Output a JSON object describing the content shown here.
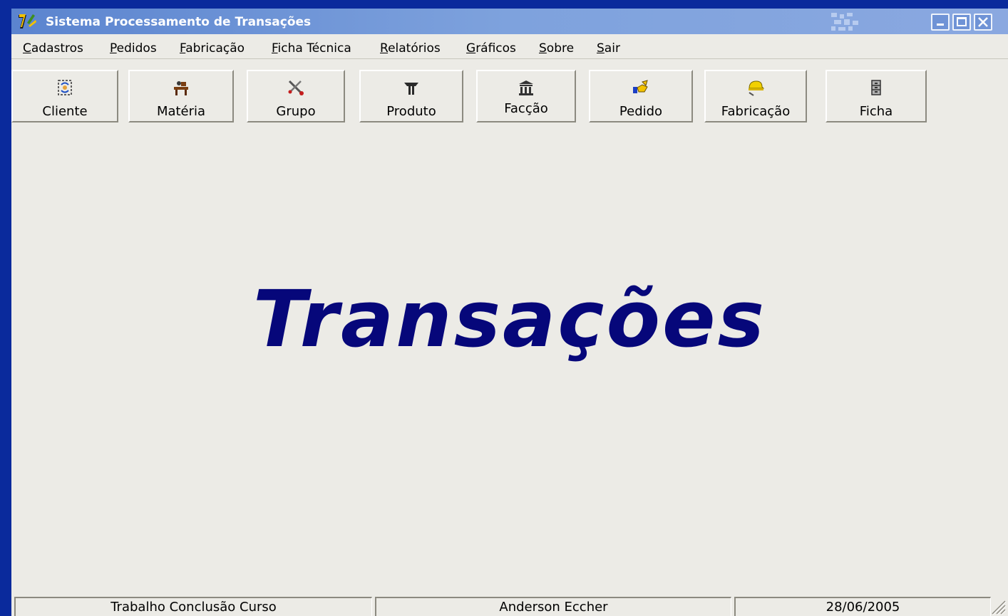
{
  "window": {
    "title": "Sistema Processamento de Transações",
    "controls": {
      "minimize_icon": "minimize-icon",
      "maximize_icon": "maximize-icon",
      "close_icon": "close-icon"
    }
  },
  "menu": [
    {
      "label": "Cadastros"
    },
    {
      "label": "Pedidos"
    },
    {
      "label": "Fabricação"
    },
    {
      "label": "Ficha Técnica"
    },
    {
      "label": "Relatórios"
    },
    {
      "label": "Gráficos"
    },
    {
      "label": "Sobre"
    },
    {
      "label": "Sair"
    }
  ],
  "toolbar": [
    {
      "label": "Cliente",
      "icon": "people-cycle-icon"
    },
    {
      "label": "Matéria",
      "icon": "workbench-icon"
    },
    {
      "label": "Grupo",
      "icon": "tools-icon"
    },
    {
      "label": "Produto",
      "icon": "anvil-icon"
    },
    {
      "label": "Facção",
      "icon": "building-icon"
    },
    {
      "label": "Pedido",
      "icon": "handshake-icon"
    },
    {
      "label": "Fabricação",
      "icon": "hardhat-icon"
    },
    {
      "label": "Ficha",
      "icon": "cabinet-icon"
    }
  ],
  "main": {
    "title": "Transações"
  },
  "statusbar": [
    {
      "text": "Trabalho Conclusão Curso"
    },
    {
      "text": "Anderson Eccher"
    },
    {
      "text": "28/06/2005"
    }
  ],
  "colors": {
    "desktop": "#0a2a9c",
    "window_bg": "#ecebe6",
    "title_text": "#ffffff",
    "main_title": "#06077a"
  }
}
